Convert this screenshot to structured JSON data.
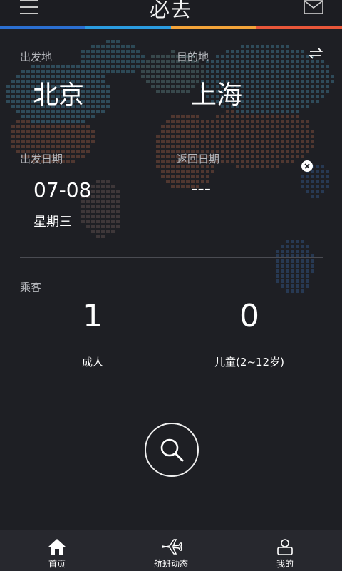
{
  "header": {
    "title": "必去",
    "menu_icon": "menu-icon",
    "mail_icon": "mail-icon",
    "accent_colors": [
      "#2b6fd1",
      "#2b9ce0",
      "#f4a43a",
      "#e8573a"
    ]
  },
  "trip": {
    "origin_label": "出发地",
    "origin_city": "北京",
    "destination_label": "目的地",
    "destination_city": "上海",
    "swap_icon": "swap-icon",
    "depart_label": "出发日期",
    "depart_date": "07-08",
    "depart_weekday": "星期三",
    "return_label": "返回日期",
    "return_date": "---",
    "clear_icon": "clear-icon"
  },
  "passengers": {
    "label": "乘客",
    "adults": "1",
    "adults_label": "成人",
    "children": "0",
    "children_label": "儿童(2~12岁)"
  },
  "search": {
    "icon": "search-icon"
  },
  "nav": {
    "items": [
      {
        "label": "首页",
        "icon": "home-icon"
      },
      {
        "label": "航班动态",
        "icon": "plane-icon"
      },
      {
        "label": "我的",
        "icon": "profile-icon"
      }
    ]
  }
}
